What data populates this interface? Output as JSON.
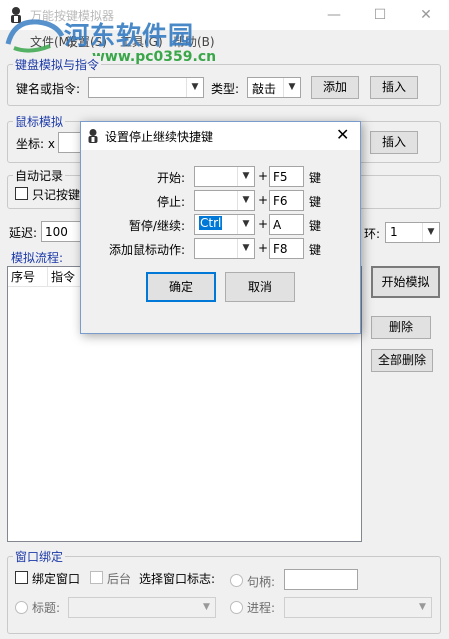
{
  "window": {
    "title": "万能按键模拟器",
    "watermark_name": "河东软件园",
    "watermark_url": "www.pc0359.cn",
    "minimize": "—",
    "maximize": "☐",
    "close": "✕"
  },
  "menu": {
    "items": [
      "文件(M)",
      "设置(S)",
      "工具(G)",
      "帮助(B)"
    ]
  },
  "keyboard_group": {
    "title": "键盘模拟与指令",
    "key_label": "键名或指令:",
    "type_label": "类型:",
    "type_value": "敲击",
    "add_button": "添加",
    "insert_button": "插入"
  },
  "mouse_group": {
    "title": "鼠标模拟",
    "coord_label": "坐标: x",
    "insert_button": "插入"
  },
  "auto_record": {
    "title": "自动记录",
    "only_record_label": "只记按键"
  },
  "delay": {
    "label": "延迟:",
    "value": "100"
  },
  "loop": {
    "label": "环:",
    "value": "1"
  },
  "flow": {
    "title": "模拟流程:",
    "columns": [
      "序号",
      "指令"
    ]
  },
  "side_buttons": {
    "start": "开始模拟",
    "delete": "删除",
    "delete_all": "全部删除"
  },
  "window_bind": {
    "title": "窗口绑定",
    "bind_window_label": "绑定窗口",
    "background_label": "后台",
    "select_mark_label": "选择窗口标志:",
    "handle_label": "句柄:",
    "title_label": "标题:",
    "process_label": "进程:"
  },
  "dialog": {
    "title": "设置停止继续快捷键",
    "close": "✕",
    "rows": [
      {
        "label": "开始:",
        "modifier": "",
        "plus": "+",
        "key": "F5",
        "suffix": "键"
      },
      {
        "label": "停止:",
        "modifier": "",
        "plus": "+",
        "key": "F6",
        "suffix": "键"
      },
      {
        "label": "暂停/继续:",
        "modifier": "Ctrl",
        "plus": "+",
        "key": "A",
        "suffix": "键"
      },
      {
        "label": "添加鼠标动作:",
        "modifier": "",
        "plus": "+",
        "key": "F8",
        "suffix": "键"
      }
    ],
    "ok_button": "确定",
    "cancel_button": "取消"
  },
  "colors": {
    "accent": "#0078d7",
    "group_title": "#1c3aa9",
    "watermark_blue": "#3a7fc4",
    "watermark_green": "#3aa64a"
  }
}
